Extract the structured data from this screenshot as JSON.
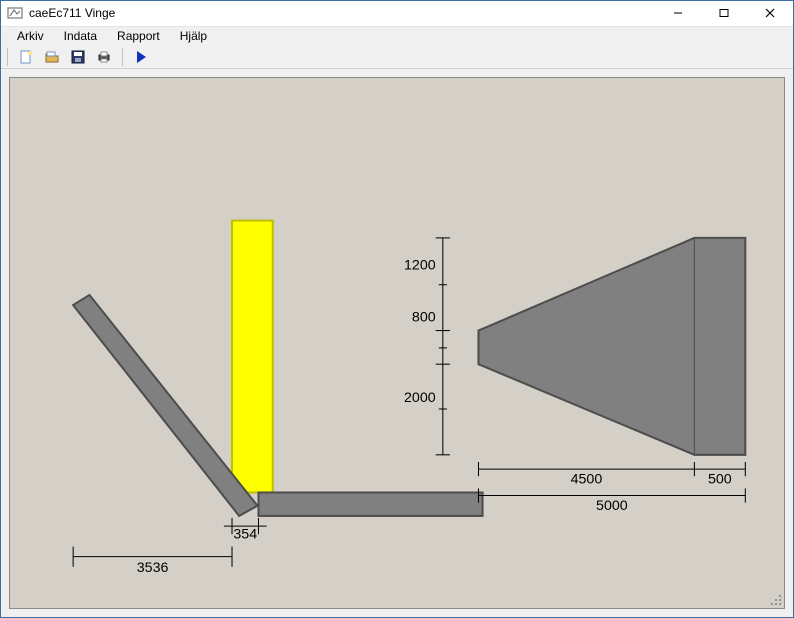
{
  "window": {
    "title": "caeEc711 Vinge"
  },
  "menubar": {
    "items": [
      "Arkiv",
      "Indata",
      "Rapport",
      "Hjälp"
    ]
  },
  "toolbar": {
    "buttons": [
      {
        "name": "new-icon"
      },
      {
        "name": "open-icon"
      },
      {
        "name": "save-icon"
      },
      {
        "name": "print-icon"
      },
      {
        "name": "run-icon"
      }
    ]
  },
  "drawing": {
    "dimensions": {
      "v_top": "1200",
      "v_mid": "800",
      "v_bot": "2000",
      "h_wedge_body": "4500",
      "h_wedge_tip": "500",
      "h_wedge_total": "5000",
      "h_footing": "354",
      "h_slope": "3536"
    }
  },
  "colors": {
    "shape": "#808080",
    "shape_stroke": "#4d4d4d",
    "highlight": "#ffff00",
    "highlight_stroke": "#bfbf00",
    "canvas_bg": "#d4d0c8"
  },
  "chart_data": {
    "type": "diagram",
    "note": "2D cross-section schematic with dimension callouts",
    "segments": [
      {
        "label": "slope leg",
        "length": 3536
      },
      {
        "label": "footing offset",
        "length": 354
      },
      {
        "label": "wedge body",
        "length": 4500
      },
      {
        "label": "wedge tip",
        "length": 500
      },
      {
        "label": "wedge total",
        "length": 5000
      },
      {
        "label": "upper height",
        "length": 1200
      },
      {
        "label": "mid height",
        "length": 800
      },
      {
        "label": "lower height",
        "length": 2000
      }
    ]
  }
}
